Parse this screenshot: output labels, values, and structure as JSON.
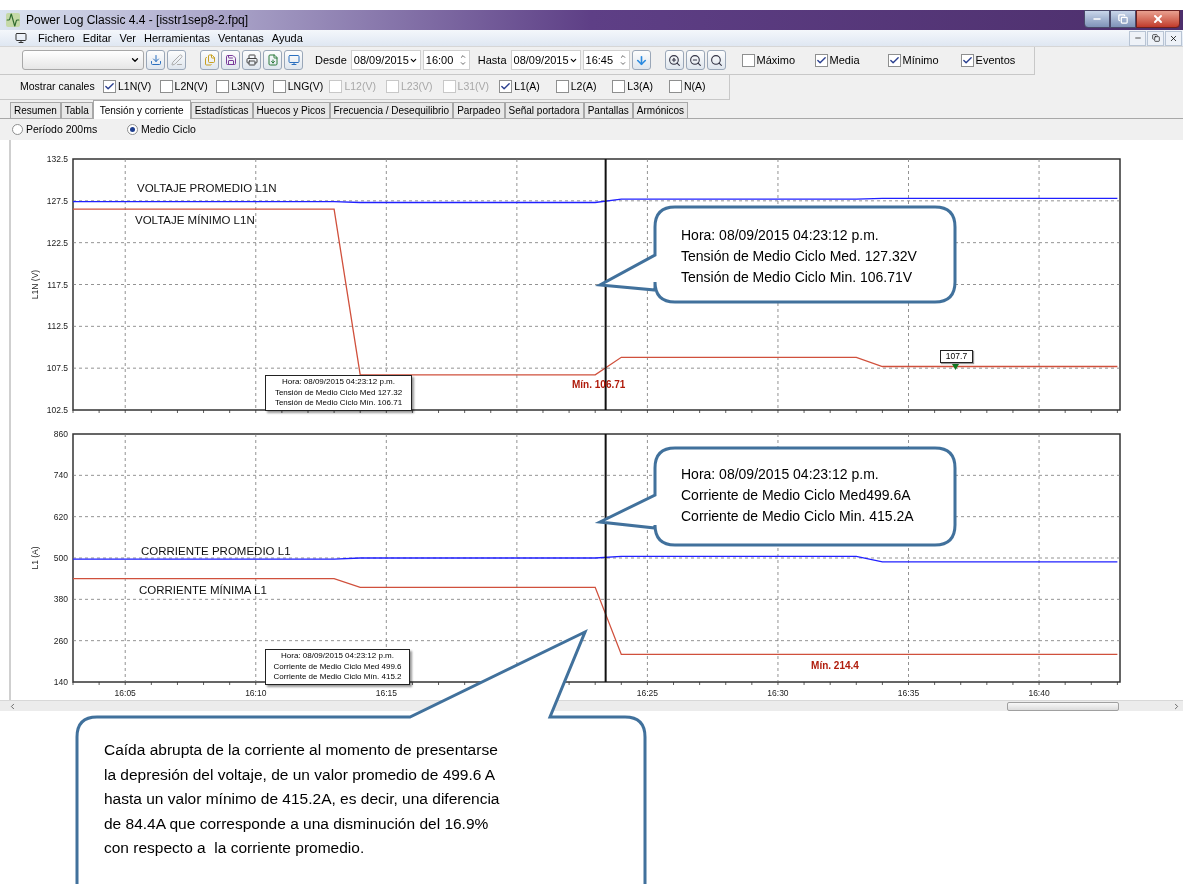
{
  "window": {
    "title": "Power Log Classic 4.4 - [isstr1sep8-2.fpq]"
  },
  "menu": [
    "Fichero",
    "Editar",
    "Ver",
    "Herramientas",
    "Ventanas",
    "Ayuda"
  ],
  "toolbar": {
    "from_label": "Desde",
    "from_date": "08/09/2015",
    "from_time": "16:00",
    "to_label": "Hasta",
    "to_date": "08/09/2015",
    "to_time": "16:45",
    "options": [
      {
        "label": "Máximo",
        "checked": false
      },
      {
        "label": "Media",
        "checked": true
      },
      {
        "label": "Mínimo",
        "checked": true
      },
      {
        "label": "Eventos",
        "checked": true
      }
    ]
  },
  "channels": {
    "label": "Mostrar canales",
    "items": [
      {
        "label": "L1N(V)",
        "checked": true,
        "disabled": false
      },
      {
        "label": "L2N(V)",
        "checked": false,
        "disabled": false
      },
      {
        "label": "L3N(V)",
        "checked": false,
        "disabled": false
      },
      {
        "label": "LNG(V)",
        "checked": false,
        "disabled": false
      },
      {
        "label": "L12(V)",
        "checked": false,
        "disabled": true
      },
      {
        "label": "L23(V)",
        "checked": false,
        "disabled": true
      },
      {
        "label": "L31(V)",
        "checked": false,
        "disabled": true
      },
      {
        "label": "L1(A)",
        "checked": true,
        "disabled": false
      },
      {
        "label": "L2(A)",
        "checked": false,
        "disabled": false
      },
      {
        "label": "L3(A)",
        "checked": false,
        "disabled": false
      },
      {
        "label": "N(A)",
        "checked": false,
        "disabled": false
      }
    ]
  },
  "tabs": [
    {
      "label": "Resumen",
      "selected": false
    },
    {
      "label": "Tabla",
      "selected": false
    },
    {
      "label": "Tensión y corriente",
      "selected": true
    },
    {
      "label": "Estadísticas",
      "selected": false
    },
    {
      "label": "Huecos y Picos",
      "selected": false
    },
    {
      "label": "Frecuencia / Desequilibrio",
      "selected": false
    },
    {
      "label": "Parpadeo",
      "selected": false
    },
    {
      "label": "Señal portadora",
      "selected": false
    },
    {
      "label": "Pantallas",
      "selected": false
    },
    {
      "label": "Armónicos",
      "selected": false
    }
  ],
  "modes": [
    {
      "label": "Período 200ms",
      "selected": false
    },
    {
      "label": "Medio Ciclo",
      "selected": true
    }
  ],
  "charts": [
    {
      "chart_data": {
        "type": "line",
        "grid": true,
        "ylabel": "L1N (V)",
        "ylim": [
          102.5,
          132.5
        ],
        "yticks": [
          102.5,
          107.5,
          112.5,
          117.5,
          122.5,
          127.5,
          132.5
        ],
        "categories": [
          null,
          null,
          null,
          null,
          null,
          null,
          null,
          null,
          null,
          null,
          null,
          null,
          null,
          null,
          null,
          null,
          null,
          null,
          null,
          null,
          null,
          null,
          null,
          null,
          null,
          null,
          null,
          null,
          null,
          null,
          null,
          null,
          null,
          null,
          null,
          null,
          null,
          null,
          null,
          null,
          null
        ],
        "series": [
          {
            "name": "VOLTAJE PROMEDIO L1N",
            "color": "#2020ff",
            "values": [
              127.4,
              127.4,
              127.4,
              127.4,
              127.4,
              127.4,
              127.4,
              127.4,
              127.4,
              127.4,
              127.4,
              127.3,
              127.3,
              127.3,
              127.3,
              127.3,
              127.3,
              127.3,
              127.3,
              127.3,
              127.3,
              127.7,
              127.7,
              127.7,
              127.7,
              127.7,
              127.7,
              127.7,
              127.7,
              127.7,
              127.7,
              127.8,
              127.8,
              127.8,
              127.8,
              127.8,
              127.8,
              127.8,
              127.8,
              127.8,
              127.8
            ]
          },
          {
            "name": "VOLTAJE MÍNIMO L1N",
            "color": "#d0503c",
            "values": [
              126.5,
              126.5,
              126.5,
              126.5,
              126.5,
              126.5,
              126.5,
              126.5,
              126.5,
              126.5,
              126.5,
              106.7,
              106.7,
              106.7,
              106.7,
              106.7,
              106.7,
              106.7,
              106.7,
              106.7,
              106.7,
              108.8,
              108.8,
              108.8,
              108.8,
              108.8,
              108.8,
              108.8,
              108.8,
              108.8,
              108.8,
              107.7,
              107.7,
              107.7,
              107.7,
              107.7,
              107.7,
              107.7,
              107.7,
              107.7,
              107.7
            ]
          }
        ]
      },
      "markers": [
        {
          "kind": "min",
          "text": "Mín. 106.71"
        },
        {
          "kind": "flag",
          "text": "107.7"
        }
      ],
      "tooltip": [
        "Hora: 08/09/2015 04:23:12 p.m.",
        "Tensión de Medio Ciclo Med 127.32",
        "Tensión de Medio Ciclo Mín. 106.71"
      ],
      "callout": [
        "Hora: 08/09/2015 04:23:12 p.m.",
        "Tensión de Medio Ciclo Med. 127.32V",
        "Tensión de Medio Ciclo Min. 106.71V"
      ]
    },
    {
      "chart_data": {
        "type": "line",
        "grid": true,
        "ylabel": "L1 (A)",
        "ylim": [
          140,
          860
        ],
        "yticks": [
          140,
          260,
          380,
          500,
          620,
          740,
          860
        ],
        "categories": [
          null,
          null,
          "16:05",
          null,
          null,
          null,
          null,
          "16:10",
          null,
          null,
          null,
          null,
          "16:15",
          null,
          null,
          null,
          null,
          null,
          null,
          null,
          null,
          null,
          "16:25",
          null,
          null,
          null,
          null,
          "16:30",
          null,
          null,
          null,
          null,
          "16:35",
          null,
          null,
          null,
          null,
          "16:40",
          null,
          null,
          null
        ],
        "series": [
          {
            "name": "CORRIENTE PROMEDIO L1",
            "color": "#2020ff",
            "values": [
              497,
              497,
              497,
              497,
              497,
              497,
              497,
              497,
              497,
              497,
              497,
              500,
              500,
              500,
              500,
              500,
              500,
              500,
              500,
              500,
              500,
              505,
              505,
              505,
              505,
              505,
              505,
              505,
              505,
              505,
              505,
              489,
              489,
              489,
              489,
              489,
              489,
              489,
              489,
              489,
              489
            ]
          },
          {
            "name": "CORRIENTE MÍNIMA L1",
            "color": "#d0503c",
            "values": [
              440,
              440,
              440,
              440,
              440,
              440,
              440,
              440,
              440,
              440,
              440,
              415,
              415,
              415,
              415,
              415,
              415,
              415,
              415,
              415,
              415,
              220,
              220,
              220,
              220,
              220,
              220,
              220,
              220,
              220,
              220,
              220,
              220,
              220,
              220,
              220,
              220,
              220,
              220,
              220,
              220
            ]
          }
        ]
      },
      "markers": [
        {
          "kind": "min",
          "text": "Mín. 214.4"
        }
      ],
      "tooltip": [
        "Hora: 08/09/2015 04:23:12 p.m.",
        "Corriente de Medio Ciclo Med 499.6",
        "Corriente de Medio Ciclo Mín. 415.2"
      ],
      "callout": [
        "Hora: 08/09/2015 04:23:12 p.m.",
        "Corriente de Medio Ciclo Med499.6A",
        "Corriente de Medio Ciclo Min. 415.2A"
      ]
    }
  ],
  "note": [
    "Caída abrupta de la corriente al momento de presentarse",
    "la depresión del voltaje, de un valor promedio de 499.6 A",
    "hasta un valor mínimo de 415.2A, es decir, una diferencia",
    "de 84.4A que corresponde a una disminución del 16.9%",
    "con respecto a  la corriente promedio."
  ]
}
